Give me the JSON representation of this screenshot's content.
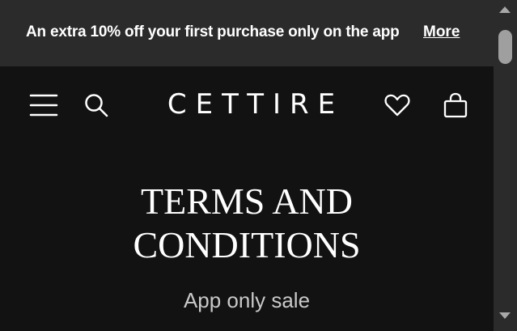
{
  "promo": {
    "text": "An extra 10% off your first purchase only on the app",
    "more_label": "More"
  },
  "header": {
    "logo": "CETTIRE",
    "icons": {
      "menu": "menu-icon",
      "search": "search-icon",
      "wishlist": "heart-icon",
      "bag": "shopping-bag-icon"
    }
  },
  "main": {
    "title_line1": "TERMS AND",
    "title_line2": "CONDITIONS",
    "subtitle": "App only sale"
  },
  "colors": {
    "background": "#121212",
    "promo_background": "#2b2b2b",
    "text": "#ffffff",
    "subtitle": "#c9c9c9"
  }
}
